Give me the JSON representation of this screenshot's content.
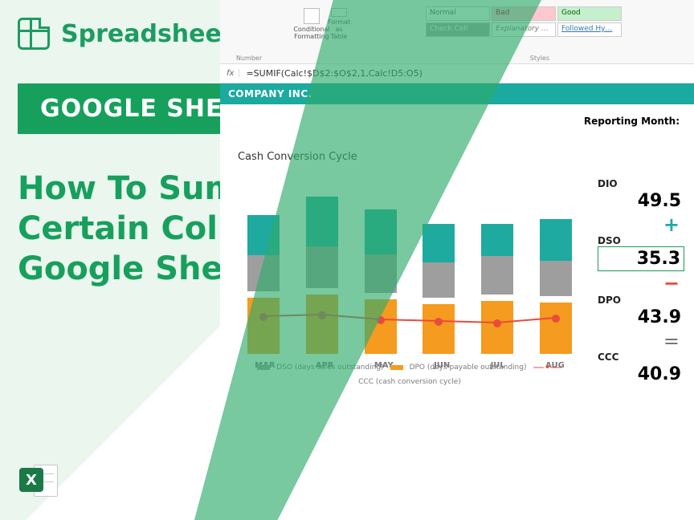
{
  "brand": "Spreadsheet Bot",
  "badge": "GOOGLE SHEETS",
  "headline": "How To Sum Only Certain Columns In Google Sheets",
  "excel_letter": "X",
  "ribbon": {
    "number_label": "Number",
    "cond_format": "Conditional Formatting",
    "format_table": "Format as Table",
    "styles_label": "Styles",
    "cells": {
      "normal": "Normal",
      "bad": "Bad",
      "good": "Good",
      "check": "Check Cell",
      "explanatory": "Explanatory …",
      "followed": "Followed Hy…"
    }
  },
  "formula_bar": {
    "fx": "fx",
    "formula": "=SUMIF(Calc!$D$2:$O$2,1,Calc!D5:O5)"
  },
  "company": "COMPANY INC.",
  "reporting_label": "Reporting Month:",
  "chart_title": "Cash Conversion Cycle",
  "metrics": {
    "dio": {
      "label": "DIO",
      "value": "49.5"
    },
    "dso": {
      "label": "DSO",
      "value": "35.3"
    },
    "dpo": {
      "label": "DPO",
      "value": "43.9"
    },
    "ccc": {
      "label": "CCC",
      "value": "40.9"
    }
  },
  "legend": {
    "dso": "DSO (days sales outstanding)",
    "dpo": "DPO (days payable outstanding)",
    "ccc": "CCC (cash conversion cycle)"
  },
  "chart_data": {
    "type": "bar",
    "stacked": true,
    "categories": [
      "MAR",
      "APR",
      "MAY",
      "JUN",
      "JUL",
      "AUG"
    ],
    "series": [
      {
        "name": "DIO",
        "color": "#1faaa0",
        "values": [
          50,
          62,
          56,
          48,
          40,
          52
        ]
      },
      {
        "name": "DSO",
        "color": "#9e9e9e",
        "values": [
          45,
          52,
          48,
          44,
          48,
          44
        ]
      },
      {
        "name": "DPO",
        "color": "#f59b1f",
        "values": [
          70,
          74,
          68,
          62,
          66,
          64
        ]
      }
    ],
    "line_series": {
      "name": "CCC",
      "color": "#e84c3d",
      "values": [
        46,
        48,
        42,
        40,
        38,
        44
      ]
    },
    "ylim": [
      0,
      200
    ]
  }
}
